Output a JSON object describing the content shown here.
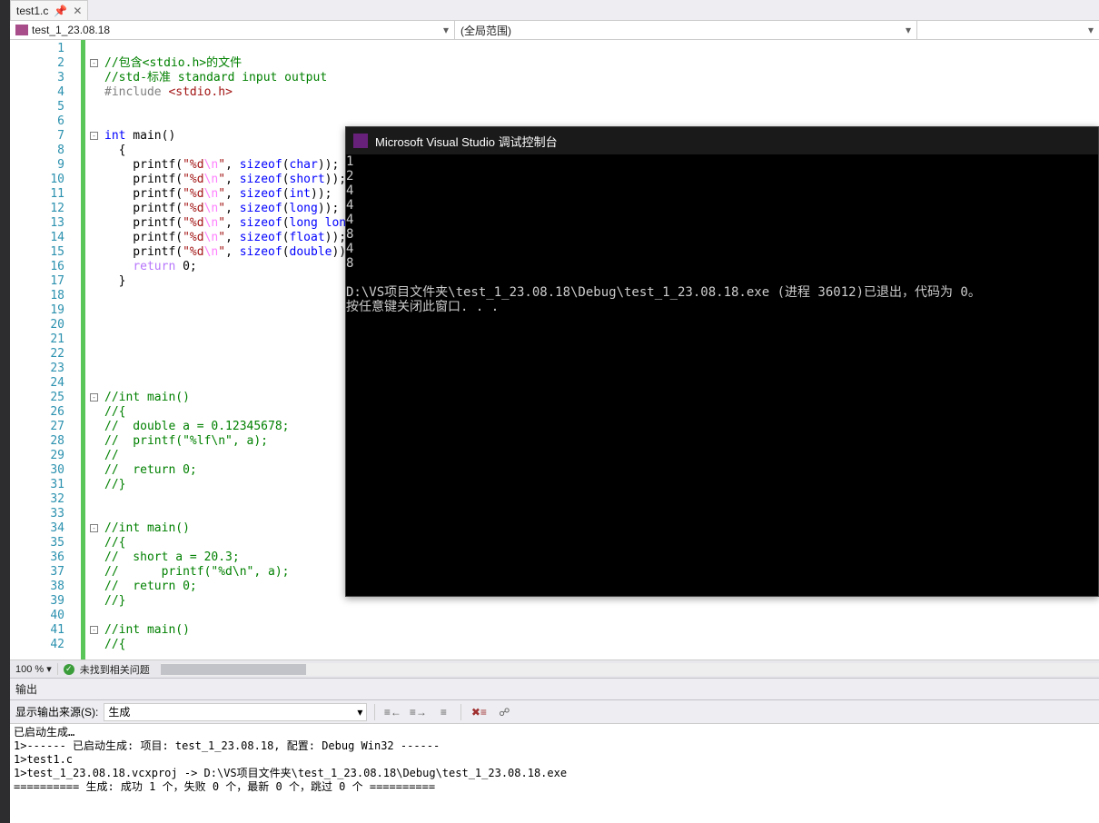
{
  "tab": {
    "name": "test1.c",
    "closable": true
  },
  "nav": {
    "scope1": "test_1_23.08.18",
    "scope2": "(全局范围)",
    "scope3": ""
  },
  "lines": [
    {
      "n": 1,
      "seg": []
    },
    {
      "n": 2,
      "fold": "-",
      "seg": [
        {
          "t": "//包含<stdio.h>的文件",
          "c": "c-comment"
        }
      ]
    },
    {
      "n": 3,
      "seg": [
        {
          "t": "//std-标准 standard input output",
          "c": "c-comment"
        }
      ]
    },
    {
      "n": 4,
      "seg": [
        {
          "t": "#include",
          "c": "c-pp"
        },
        {
          "t": " "
        },
        {
          "t": "<stdio.h>",
          "c": "c-inc"
        }
      ]
    },
    {
      "n": 5,
      "seg": []
    },
    {
      "n": 6,
      "seg": []
    },
    {
      "n": 7,
      "fold": "-",
      "seg": [
        {
          "t": "int",
          "c": "c-kw"
        },
        {
          "t": " main()"
        }
      ]
    },
    {
      "n": 8,
      "seg": [
        {
          "t": "  {"
        }
      ]
    },
    {
      "n": 9,
      "seg": [
        {
          "t": "    printf("
        },
        {
          "t": "\"%d",
          "c": "c-str"
        },
        {
          "t": "\\n",
          "c": "c-esc"
        },
        {
          "t": "\"",
          "c": "c-str"
        },
        {
          "t": ", "
        },
        {
          "t": "sizeof",
          "c": "c-kw"
        },
        {
          "t": "("
        },
        {
          "t": "char",
          "c": "c-kw"
        },
        {
          "t": "));"
        }
      ]
    },
    {
      "n": 10,
      "seg": [
        {
          "t": "    printf("
        },
        {
          "t": "\"%d",
          "c": "c-str"
        },
        {
          "t": "\\n",
          "c": "c-esc"
        },
        {
          "t": "\"",
          "c": "c-str"
        },
        {
          "t": ", "
        },
        {
          "t": "sizeof",
          "c": "c-kw"
        },
        {
          "t": "("
        },
        {
          "t": "short",
          "c": "c-kw"
        },
        {
          "t": "));"
        }
      ]
    },
    {
      "n": 11,
      "seg": [
        {
          "t": "    printf("
        },
        {
          "t": "\"%d",
          "c": "c-str"
        },
        {
          "t": "\\n",
          "c": "c-esc"
        },
        {
          "t": "\"",
          "c": "c-str"
        },
        {
          "t": ", "
        },
        {
          "t": "sizeof",
          "c": "c-kw"
        },
        {
          "t": "("
        },
        {
          "t": "int",
          "c": "c-kw"
        },
        {
          "t": "));"
        }
      ]
    },
    {
      "n": 12,
      "seg": [
        {
          "t": "    printf("
        },
        {
          "t": "\"%d",
          "c": "c-str"
        },
        {
          "t": "\\n",
          "c": "c-esc"
        },
        {
          "t": "\"",
          "c": "c-str"
        },
        {
          "t": ", "
        },
        {
          "t": "sizeof",
          "c": "c-kw"
        },
        {
          "t": "("
        },
        {
          "t": "long",
          "c": "c-kw"
        },
        {
          "t": "));"
        }
      ]
    },
    {
      "n": 13,
      "seg": [
        {
          "t": "    printf("
        },
        {
          "t": "\"%d",
          "c": "c-str"
        },
        {
          "t": "\\n",
          "c": "c-esc"
        },
        {
          "t": "\"",
          "c": "c-str"
        },
        {
          "t": ", "
        },
        {
          "t": "sizeof",
          "c": "c-kw"
        },
        {
          "t": "("
        },
        {
          "t": "long long",
          "c": "c-kw"
        },
        {
          "t": "));"
        }
      ]
    },
    {
      "n": 14,
      "seg": [
        {
          "t": "    printf("
        },
        {
          "t": "\"%d",
          "c": "c-str"
        },
        {
          "t": "\\n",
          "c": "c-esc"
        },
        {
          "t": "\"",
          "c": "c-str"
        },
        {
          "t": ", "
        },
        {
          "t": "sizeof",
          "c": "c-kw"
        },
        {
          "t": "("
        },
        {
          "t": "float",
          "c": "c-kw"
        },
        {
          "t": "));"
        }
      ]
    },
    {
      "n": 15,
      "seg": [
        {
          "t": "    printf("
        },
        {
          "t": "\"%d",
          "c": "c-str"
        },
        {
          "t": "\\n",
          "c": "c-esc"
        },
        {
          "t": "\"",
          "c": "c-str"
        },
        {
          "t": ", "
        },
        {
          "t": "sizeof",
          "c": "c-kw"
        },
        {
          "t": "("
        },
        {
          "t": "double",
          "c": "c-kw"
        },
        {
          "t": "));"
        }
      ]
    },
    {
      "n": 16,
      "seg": [
        {
          "t": "    "
        },
        {
          "t": "return",
          "c": "c-ctrl"
        },
        {
          "t": " 0;"
        }
      ]
    },
    {
      "n": 17,
      "seg": [
        {
          "t": "  }"
        }
      ]
    },
    {
      "n": 18,
      "seg": []
    },
    {
      "n": 19,
      "seg": []
    },
    {
      "n": 20,
      "seg": []
    },
    {
      "n": 21,
      "seg": []
    },
    {
      "n": 22,
      "seg": []
    },
    {
      "n": 23,
      "seg": []
    },
    {
      "n": 24,
      "seg": []
    },
    {
      "n": 25,
      "fold": "-",
      "seg": [
        {
          "t": "//int main()",
          "c": "c-comment"
        }
      ]
    },
    {
      "n": 26,
      "seg": [
        {
          "t": "//{",
          "c": "c-comment"
        }
      ]
    },
    {
      "n": 27,
      "seg": [
        {
          "t": "//  double a = 0.12345678;",
          "c": "c-comment"
        }
      ]
    },
    {
      "n": 28,
      "seg": [
        {
          "t": "//  printf(\"%lf\\n\", a);",
          "c": "c-comment"
        }
      ]
    },
    {
      "n": 29,
      "seg": [
        {
          "t": "//",
          "c": "c-comment"
        }
      ]
    },
    {
      "n": 30,
      "seg": [
        {
          "t": "//  return 0;",
          "c": "c-comment"
        }
      ]
    },
    {
      "n": 31,
      "seg": [
        {
          "t": "//}",
          "c": "c-comment"
        }
      ]
    },
    {
      "n": 32,
      "seg": []
    },
    {
      "n": 33,
      "seg": []
    },
    {
      "n": 34,
      "fold": "-",
      "seg": [
        {
          "t": "//int main()",
          "c": "c-comment"
        }
      ]
    },
    {
      "n": 35,
      "seg": [
        {
          "t": "//{",
          "c": "c-comment"
        }
      ]
    },
    {
      "n": 36,
      "seg": [
        {
          "t": "//  short a = 20.3;",
          "c": "c-comment"
        }
      ]
    },
    {
      "n": 37,
      "seg": [
        {
          "t": "//      printf(\"%d\\n\", a);",
          "c": "c-comment"
        }
      ]
    },
    {
      "n": 38,
      "seg": [
        {
          "t": "//  return 0;",
          "c": "c-comment"
        }
      ]
    },
    {
      "n": 39,
      "seg": [
        {
          "t": "//}",
          "c": "c-comment"
        }
      ]
    },
    {
      "n": 40,
      "seg": []
    },
    {
      "n": 41,
      "fold": "-",
      "seg": [
        {
          "t": "//int main()",
          "c": "c-comment"
        }
      ]
    },
    {
      "n": 42,
      "seg": [
        {
          "t": "//{",
          "c": "c-comment"
        }
      ]
    }
  ],
  "console": {
    "title": "Microsoft Visual Studio 调试控制台",
    "lines": [
      "1",
      "2",
      "4",
      "4",
      "4",
      "8",
      "4",
      "8",
      "",
      "D:\\VS项目文件夹\\test_1_23.08.18\\Debug\\test_1_23.08.18.exe (进程 36012)已退出，代码为 0。",
      "按任意键关闭此窗口. . ."
    ]
  },
  "status": {
    "zoom": "100 %",
    "issues": "未找到相关问题"
  },
  "output": {
    "title": "输出",
    "sourceLabel": "显示输出来源(S):",
    "sourceValue": "生成",
    "lines": [
      "已启动生成…",
      "1>------ 已启动生成: 项目: test_1_23.08.18, 配置: Debug Win32 ------",
      "1>test1.c",
      "1>test_1_23.08.18.vcxproj -> D:\\VS项目文件夹\\test_1_23.08.18\\Debug\\test_1_23.08.18.exe",
      "========== 生成: 成功 1 个，失败 0 个，最新 0 个，跳过 0 个 =========="
    ]
  }
}
